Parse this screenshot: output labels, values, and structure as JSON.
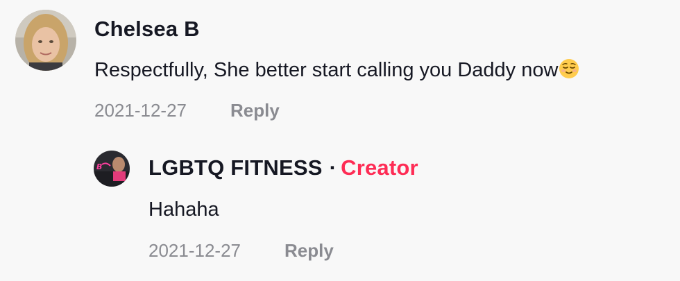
{
  "comment": {
    "author": "Chelsea B",
    "text": "Respectfully, She better start calling you Daddy now",
    "emoji": "relieved-face-emoji",
    "date": "2021-12-27",
    "reply_label": "Reply"
  },
  "reply": {
    "author": "LGBTQ FITNESS",
    "separator": "·",
    "badge": "Creator",
    "text": "Hahaha",
    "date": "2021-12-27",
    "reply_label": "Reply"
  },
  "colors": {
    "background": "#f8f8f8",
    "text": "#161823",
    "muted": "#8a8b91",
    "creator": "#fe2c55"
  }
}
